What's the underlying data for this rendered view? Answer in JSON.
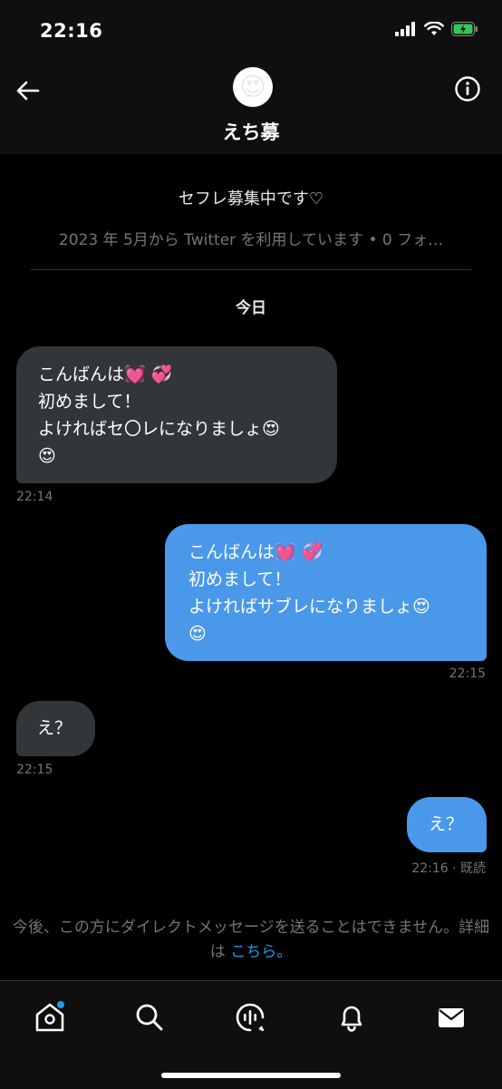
{
  "status": {
    "time": "22:16"
  },
  "header": {
    "avatar_emoji": "😍",
    "name": "えち募"
  },
  "profile": {
    "bio": "セフレ募集中です♡",
    "meta": "2023 年 5月から Twitter を利用しています • 0 フォ…"
  },
  "date_separator": "今日",
  "messages": [
    {
      "side": "received",
      "lines": [
        "こんばんは💓 💞",
        "初めまして！",
        "よければセ〇レになりましょ😍",
        "😍"
      ],
      "time": "22:14"
    },
    {
      "side": "sent",
      "lines": [
        "こんばんは💓 💞",
        "初めまして！",
        "よければサブレになりましょ😍",
        "😍"
      ],
      "time": "22:15"
    },
    {
      "side": "received",
      "lines": [
        "え？"
      ],
      "time": "22:15"
    },
    {
      "side": "sent",
      "lines": [
        "え？"
      ],
      "time": "22:16 · 既読"
    }
  ],
  "notice": {
    "text": "今後、この方にダイレクトメッセージを送ることはできません。詳細は ",
    "link": "こちら。"
  },
  "nav": [
    "home-icon",
    "search-icon",
    "spaces-icon",
    "notifications-icon",
    "messages-icon"
  ],
  "colors": {
    "background": "#000000",
    "bubble_received": "#333639",
    "bubble_sent": "#4a98e9",
    "link": "#1d9bf0",
    "muted": "#71767b"
  }
}
